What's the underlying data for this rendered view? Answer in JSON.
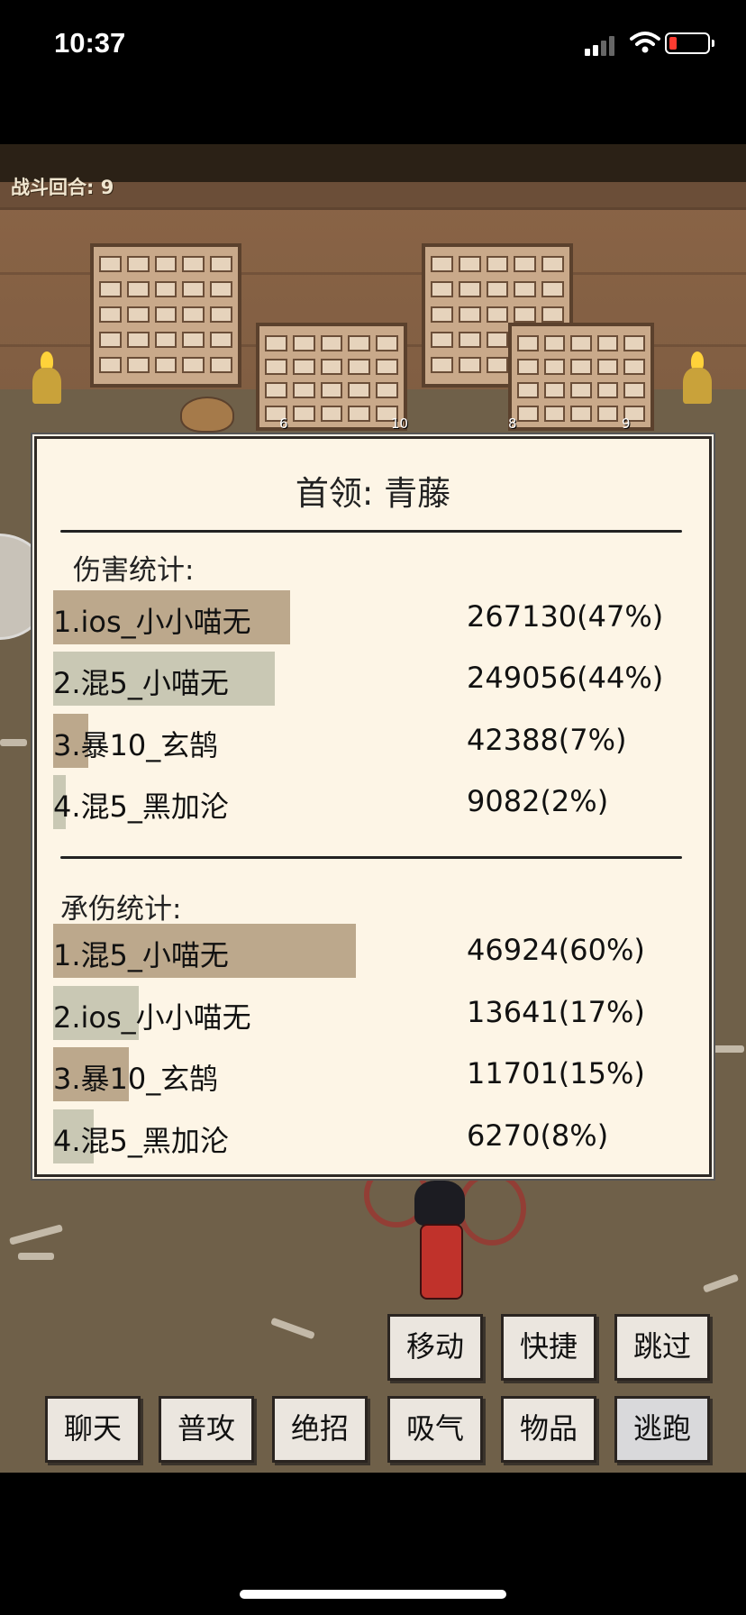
{
  "status_bar": {
    "time": "10:37"
  },
  "scene": {
    "round_label": "战斗回合: 9",
    "cabinet_numbers": [
      "6",
      "10",
      "8",
      "9"
    ]
  },
  "panel": {
    "title": "首领: 青藤",
    "damage": {
      "label": "伤害统计:",
      "rows": [
        {
          "name": "1.ios_小小喵无",
          "value": "267130(47%)",
          "percent": 47,
          "color": "#bca88c"
        },
        {
          "name": "2.混5_小喵无",
          "value": "249056(44%)",
          "percent": 44,
          "color": "#c9c8b4"
        },
        {
          "name": "3.暴10_玄鹄",
          "value": "42388(7%)",
          "percent": 7,
          "color": "#bca88c"
        },
        {
          "name": "4.混5_黑加沦",
          "value": "9082(2%)",
          "percent": 2,
          "color": "#c9c8b4"
        }
      ]
    },
    "taken": {
      "label": "承伤统计:",
      "rows": [
        {
          "name": "1.混5_小喵无",
          "value": "46924(60%)",
          "percent": 60,
          "color": "#bca88c"
        },
        {
          "name": "2.ios_小小喵无",
          "value": "13641(17%)",
          "percent": 17,
          "color": "#c9c8b4"
        },
        {
          "name": "3.暴10_玄鹄",
          "value": "11701(15%)",
          "percent": 15,
          "color": "#bca88c"
        },
        {
          "name": "4.混5_黑加沦",
          "value": "6270(8%)",
          "percent": 8,
          "color": "#c9c8b4"
        }
      ]
    }
  },
  "buttons": {
    "move": "移动",
    "shortcut": "快捷",
    "skip": "跳过",
    "chat": "聊天",
    "attack": "普攻",
    "ultimate": "绝招",
    "breathe": "吸气",
    "items": "物品",
    "flee": "逃跑"
  }
}
